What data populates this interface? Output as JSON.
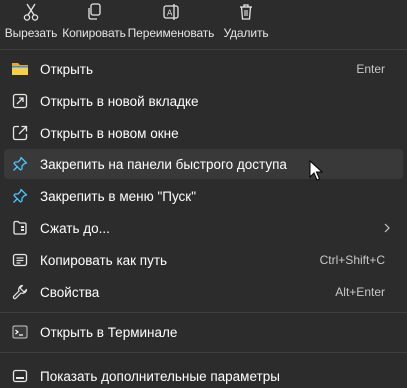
{
  "toolbar": {
    "cut_label": "Вырезать",
    "copy_label": "Копировать",
    "rename_label": "Переименовать",
    "delete_label": "Удалить"
  },
  "menu": {
    "items": [
      {
        "label": "Открыть",
        "shortcut": "Enter",
        "icon": "folder-icon"
      },
      {
        "label": "Открыть в новой вкладке",
        "shortcut": "",
        "icon": "new-tab-icon"
      },
      {
        "label": "Открыть в новом окне",
        "shortcut": "",
        "icon": "new-window-icon"
      },
      {
        "label": "Закрепить на панели быстрого доступа",
        "shortcut": "",
        "icon": "pin-icon"
      },
      {
        "label": "Закрепить в меню \"Пуск\"",
        "shortcut": "",
        "icon": "pin-start-icon"
      },
      {
        "label": "Сжать до...",
        "shortcut": "",
        "icon": "zip-icon"
      },
      {
        "label": "Копировать как путь",
        "shortcut": "Ctrl+Shift+C",
        "icon": "copy-path-icon"
      },
      {
        "label": "Свойства",
        "shortcut": "Alt+Enter",
        "icon": "wrench-icon"
      },
      {
        "label": "Открыть в Терминале",
        "shortcut": "",
        "icon": "terminal-icon"
      },
      {
        "label": "Показать дополнительные параметры",
        "shortcut": "",
        "icon": "more-options-icon"
      }
    ]
  },
  "colors": {
    "background": "#2c2c2c",
    "hover": "#393939",
    "accent": "#4cc2ff",
    "folder": "#f0c040"
  }
}
